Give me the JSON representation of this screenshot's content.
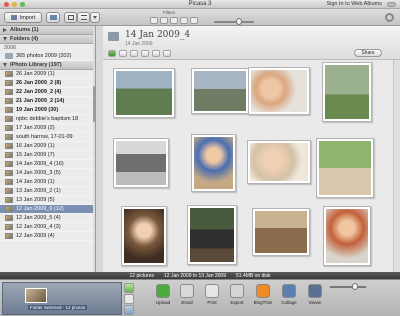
{
  "window": {
    "title": "Picasa 3",
    "sign_in": "Sign In to Web Albums"
  },
  "toolbar": {
    "import_label": "Import",
    "filters_label": "Filters"
  },
  "sidebar": {
    "albums_header": "Albums (1)",
    "folders_header": "Folders (4)",
    "year_label": "2006",
    "folder_2006": "365 photos 2009 (202)",
    "iphoto_header": "iPhoto Library (197)",
    "events": [
      {
        "label": "26 Jan 2009 (1)",
        "bold": false
      },
      {
        "label": "26 Jan 2009_2 (8)",
        "bold": true
      },
      {
        "label": "22 Jan 2009_2 (4)",
        "bold": true
      },
      {
        "label": "21 Jan 2009_2 (14)",
        "bold": true
      },
      {
        "label": "19 Jan 2009 (30)",
        "bold": true
      },
      {
        "label": "npbc debbie's baptism 18",
        "bold": false
      },
      {
        "label": "17 Jan 2009 (2)",
        "bold": false
      },
      {
        "label": "south harrow, 17-01-09",
        "bold": false
      },
      {
        "label": "16 Jan 2009 (1)",
        "bold": false
      },
      {
        "label": "15 Jan 2009 (7)",
        "bold": false
      },
      {
        "label": "14 Jan 2009_4 (16)",
        "bold": false
      },
      {
        "label": "14 Jan 2009_3 (5)",
        "bold": false
      },
      {
        "label": "14 Jan 2009 (1)",
        "bold": false
      },
      {
        "label": "13 Jan 2009_2 (1)",
        "bold": false
      },
      {
        "label": "13 Jan 2009 (5)",
        "bold": false
      },
      {
        "label": "12 Jan 2009_6 (12)",
        "bold": false
      },
      {
        "label": "12 Jan 2009_5 (4)",
        "bold": false
      },
      {
        "label": "12 Jan 2009_4 (3)",
        "bold": false
      },
      {
        "label": "12 Jan 2009 (4)",
        "bold": false
      }
    ]
  },
  "album": {
    "title": "14 Jan 2009_4",
    "date": "14 Jan 2009",
    "share_label": "Share"
  },
  "status": {
    "pictures": "12 pictures",
    "range": "12 Jan 2009 to 13 Jan 2009",
    "size": "51.4MB on disk"
  },
  "tray": {
    "selection_label": "Folder Selected - 12 photos"
  },
  "actions": [
    {
      "label": "Upload",
      "color": "#4caa3f"
    },
    {
      "label": "Email",
      "color": "#d9d9d9"
    },
    {
      "label": "Print",
      "color": "#e5e5e5"
    },
    {
      "label": "Export",
      "color": "#d4d4d4"
    },
    {
      "label": "BlogThis!",
      "color": "#f08a24"
    },
    {
      "label": "Collage",
      "color": "#5b7fb0"
    },
    {
      "label": "Movie",
      "color": "#5a6f94"
    }
  ],
  "colors": {
    "selection": "#7b8fb3",
    "status_bar": "#454545"
  }
}
